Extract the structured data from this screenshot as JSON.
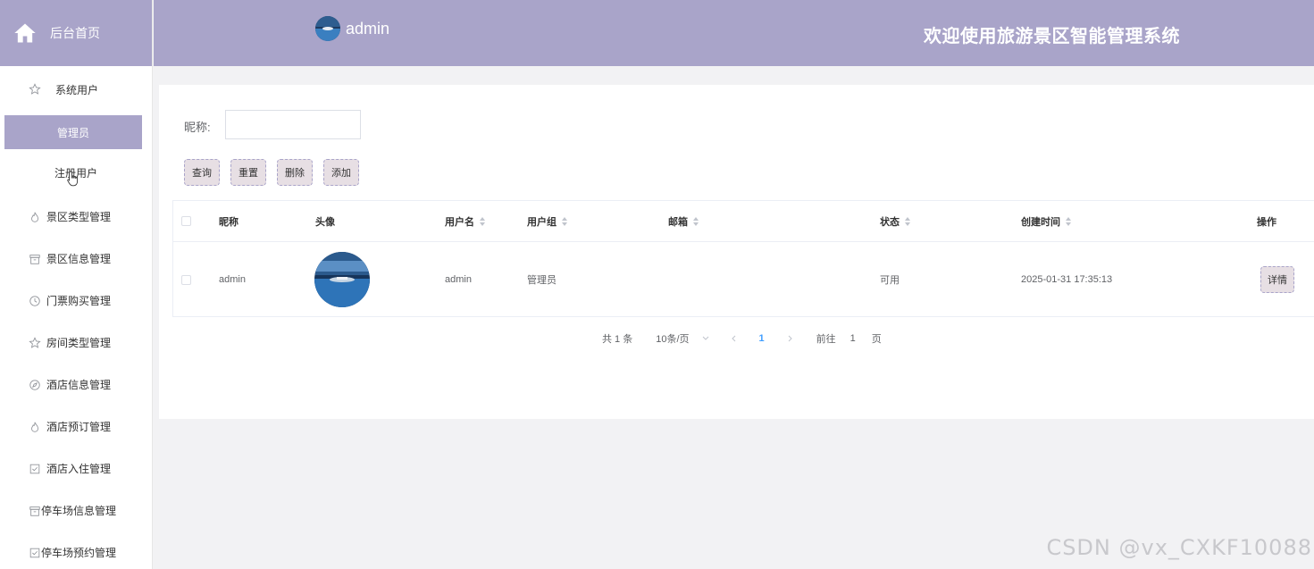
{
  "brand": {
    "label": "后台首页",
    "icon": "home-icon"
  },
  "header": {
    "username": "admin",
    "title": "欢迎使用旅游景区智能管理系统"
  },
  "sidebar": {
    "group": {
      "label": "系统用户",
      "icon": "star-icon"
    },
    "sub_items": [
      {
        "label": "管理员",
        "active": true
      },
      {
        "label": "注册用户",
        "active": false
      }
    ],
    "items": [
      {
        "label": "景区类型管理",
        "icon": "flame-icon"
      },
      {
        "label": "景区信息管理",
        "icon": "box-icon"
      },
      {
        "label": "门票购买管理",
        "icon": "clock-icon"
      },
      {
        "label": "房间类型管理",
        "icon": "star-icon"
      },
      {
        "label": "酒店信息管理",
        "icon": "compass-icon"
      },
      {
        "label": "酒店预订管理",
        "icon": "flame-icon"
      },
      {
        "label": "酒店入住管理",
        "icon": "checkbox-icon"
      },
      {
        "label": "停车场信息管理",
        "icon": "box-icon"
      },
      {
        "label": "停车场预约管理",
        "icon": "checkbox-icon"
      }
    ]
  },
  "search": {
    "label": "昵称:",
    "value": "",
    "placeholder": ""
  },
  "buttons": {
    "query": "查询",
    "reset": "重置",
    "delete": "删除",
    "add": "添加"
  },
  "table": {
    "headers": {
      "nickname": "昵称",
      "avatar": "头像",
      "username": "用户名",
      "group": "用户组",
      "email": "邮箱",
      "status": "状态",
      "created": "创建时间",
      "actions": "操作"
    },
    "rows": [
      {
        "nickname": "admin",
        "username": "admin",
        "group": "管理员",
        "email": "",
        "status": "可用",
        "created": "2025-01-31 17:35:13",
        "action": "详情"
      }
    ]
  },
  "pagination": {
    "total": "共 1 条",
    "page_size": "10条/页",
    "current_page": "1",
    "goto_label": "前往",
    "goto_value": "1",
    "goto_suffix": "页"
  },
  "watermark": "CSDN @vx_CXKF10088",
  "colors": {
    "accent": "#a9a4c9",
    "button_bg": "#e7dfe4",
    "page_link": "#409eff"
  }
}
